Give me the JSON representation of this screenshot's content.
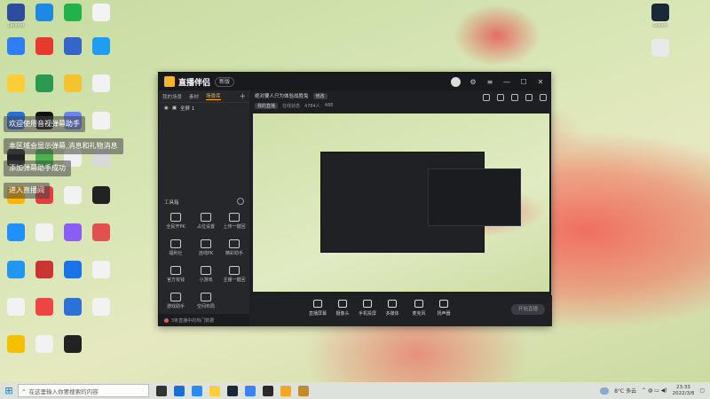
{
  "desktop": {
    "icons": [
      {
        "label": "Lenovo",
        "color": "#2b4d9c"
      },
      {
        "label": "",
        "color": "#1e88e5"
      },
      {
        "label": "",
        "color": "#21b34a"
      },
      {
        "label": "",
        "color": "#f3f3f3"
      },
      {
        "label": "",
        "color": "#2d7ef7"
      },
      {
        "label": "",
        "color": "#e8392f"
      },
      {
        "label": "",
        "color": "#3565c9"
      },
      {
        "label": "",
        "color": "#1f9df0"
      },
      {
        "label": "",
        "color": "#ffcd35"
      },
      {
        "label": "",
        "color": "#2a9a53"
      },
      {
        "label": "",
        "color": "#f4c430"
      },
      {
        "label": "",
        "color": "#f2f2f2"
      },
      {
        "label": "",
        "color": "#2a6fd6"
      },
      {
        "label": "",
        "color": "#101010"
      },
      {
        "label": "",
        "color": "#6a86f0"
      },
      {
        "label": "",
        "color": "#f2f2f2"
      },
      {
        "label": "",
        "color": "#222"
      },
      {
        "label": "",
        "color": "#4caf50"
      },
      {
        "label": "",
        "color": "#f0f0f0"
      },
      {
        "label": "",
        "color": "#d9d9d9"
      },
      {
        "label": "",
        "color": "#ffb400"
      },
      {
        "label": "",
        "color": "#e43d3d"
      },
      {
        "label": "",
        "color": "#f2f2f2"
      },
      {
        "label": "",
        "color": "#222"
      },
      {
        "label": "",
        "color": "#1e90ff"
      },
      {
        "label": "",
        "color": "#f2f2f2"
      },
      {
        "label": "",
        "color": "#8b5cf6"
      },
      {
        "label": "",
        "color": "#e25050"
      },
      {
        "label": "",
        "color": "#2196f3"
      },
      {
        "label": "",
        "color": "#cc3333"
      },
      {
        "label": "",
        "color": "#1a73e8"
      },
      {
        "label": "",
        "color": "#f2f2f2"
      },
      {
        "label": "",
        "color": "#f2f2f2"
      },
      {
        "label": "",
        "color": "#e44"
      },
      {
        "label": "",
        "color": "#2a72d6"
      },
      {
        "label": "",
        "color": "#f2f2f2"
      },
      {
        "label": "",
        "color": "#f5c000"
      },
      {
        "label": "",
        "color": "#f2f2f2"
      },
      {
        "label": "",
        "color": "#222"
      }
    ],
    "right_icons": [
      {
        "label": "Steam",
        "color": "#1b2838"
      },
      {
        "label": "",
        "color": "#e9e9e9"
      }
    ]
  },
  "toasts": [
    "欢迎使用音视弹幕助手",
    "本区域会显示弹幕,消息和礼物消息",
    "添加弹幕助手成功",
    "进入直播间"
  ],
  "app": {
    "name": "直播伴侣",
    "version": "新版",
    "sidebar_tabs": [
      "我的场景",
      "素材",
      "场景库"
    ],
    "scene_name": "全屏 1",
    "tools_header": "工具箱",
    "tools": [
      {
        "label": "全民开PK"
      },
      {
        "label": "占位设置"
      },
      {
        "label": "上传一键回"
      },
      {
        "label": "福利社"
      },
      {
        "label": "连线PK"
      },
      {
        "label": "精彩助手"
      },
      {
        "label": "官方有钱"
      },
      {
        "label": "小游戏"
      },
      {
        "label": "主播一键回"
      },
      {
        "label": "游戏助手"
      },
      {
        "label": "空间布局"
      }
    ],
    "status_text": "3条直播中的热门数据",
    "stream_title": "绝对要人只为体验战胜兔",
    "edit_label": "修改",
    "sub_info": [
      "我的直播",
      "在线状态",
      "4784人",
      "488"
    ],
    "controls": [
      {
        "label": "直播屏幕"
      },
      {
        "label": "摄像头"
      },
      {
        "label": "手机投屏"
      },
      {
        "label": "多媒体"
      },
      {
        "label": "麦克风"
      },
      {
        "label": "扬声器"
      }
    ],
    "go_live_label": "开始直播"
  },
  "taskbar": {
    "search_placeholder": "在这里输入你要搜索的内容",
    "apps": [
      {
        "color": "#333"
      },
      {
        "color": "#1a6fd6"
      },
      {
        "color": "#2a8cf3"
      },
      {
        "color": "#ffcd35"
      },
      {
        "color": "#1b2838"
      },
      {
        "color": "#3b82f6"
      },
      {
        "color": "#2a2a2a"
      },
      {
        "color": "#f5a623"
      },
      {
        "color": "#c58a2b"
      }
    ],
    "weather": "8°C 多云",
    "time": "23:33",
    "date": "2022/3/8"
  }
}
